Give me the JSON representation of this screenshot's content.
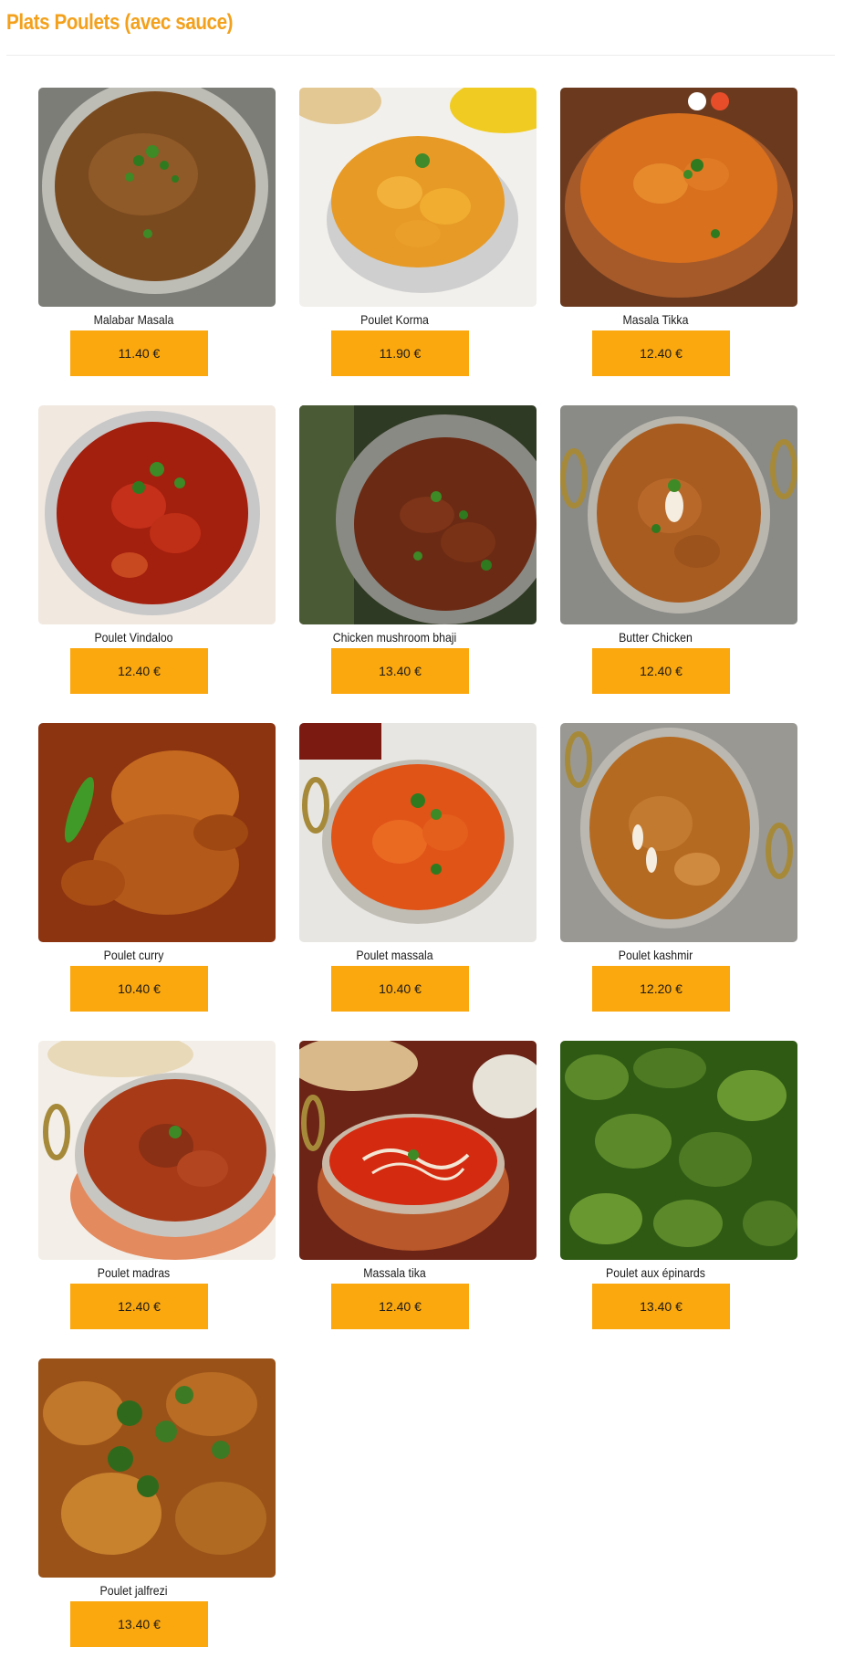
{
  "header": {
    "title": "Plats Poulets (avec sauce)"
  },
  "theme": {
    "title_color": "#f3a11c",
    "price_button_color": "#fba70e"
  },
  "dishes": [
    {
      "name": "Malabar Masala",
      "price": "11.40 €",
      "photo": "brown-curry-bowl-photo"
    },
    {
      "name": "Poulet Korma",
      "price": "11.90 €",
      "photo": "korma-bowl-photo"
    },
    {
      "name": "Masala Tikka",
      "price": "12.40 €",
      "photo": "tikka-copper-bowl-photo"
    },
    {
      "name": "Poulet Vindaloo",
      "price": "12.40 €",
      "photo": "vindaloo-bowl-photo"
    },
    {
      "name": "Chicken mushroom bhaji",
      "price": "13.40 €",
      "photo": "mushroom-bhaji-bowl-photo"
    },
    {
      "name": "Butter Chicken",
      "price": "12.40 €",
      "photo": "butter-chicken-bowl-photo"
    },
    {
      "name": "Poulet curry",
      "price": "10.40 €",
      "photo": "chicken-curry-closeup-photo"
    },
    {
      "name": "Poulet massala",
      "price": "10.40 €",
      "photo": "massala-bowl-photo"
    },
    {
      "name": "Poulet kashmir",
      "price": "12.20 €",
      "photo": "kashmir-bowl-photo"
    },
    {
      "name": "Poulet madras",
      "price": "12.40 €",
      "photo": "madras-copper-bowl-photo"
    },
    {
      "name": "Massala tika",
      "price": "12.40 €",
      "photo": "tika-cream-bowl-photo"
    },
    {
      "name": "Poulet aux épinards",
      "price": "13.40 €",
      "photo": "spinach-chicken-photo"
    },
    {
      "name": "Poulet jalfrezi",
      "price": "13.40 €",
      "photo": "jalfrezi-closeup-photo"
    }
  ]
}
